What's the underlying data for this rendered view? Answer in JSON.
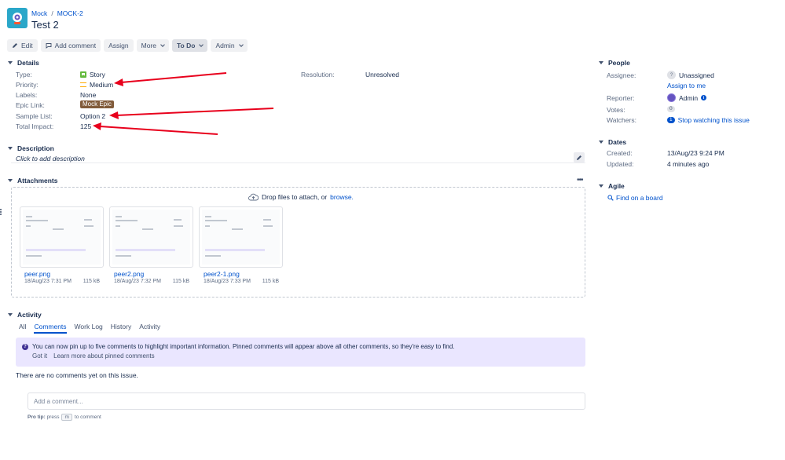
{
  "header": {
    "project_name": "Mock",
    "issue_key": "MOCK-2",
    "separator": "/",
    "title": "Test 2"
  },
  "toolbar": {
    "edit": "Edit",
    "add_comment": "Add comment",
    "assign": "Assign",
    "more": "More",
    "status": "To Do",
    "admin": "Admin"
  },
  "details": {
    "heading": "Details",
    "type_label": "Type:",
    "type_value": "Story",
    "priority_label": "Priority:",
    "priority_value": "Medium",
    "labels_label": "Labels:",
    "labels_value": "None",
    "epic_label": "Epic Link:",
    "epic_value": "Mock Epic",
    "sample_label": "Sample List:",
    "sample_value": "Option 2",
    "impact_label": "Total Impact:",
    "impact_value": "125",
    "resolution_label": "Resolution:",
    "resolution_value": "Unresolved"
  },
  "description": {
    "heading": "Description",
    "placeholder": "Click to add description"
  },
  "attachments": {
    "heading": "Attachments",
    "drop_text": "Drop files to attach, or",
    "browse": "browse.",
    "files": [
      {
        "name": "peer.png",
        "date": "18/Aug/23 7:31 PM",
        "size": "115 kB"
      },
      {
        "name": "peer2.png",
        "date": "18/Aug/23 7:32 PM",
        "size": "115 kB"
      },
      {
        "name": "peer2-1.png",
        "date": "18/Aug/23 7:33 PM",
        "size": "115 kB"
      }
    ]
  },
  "activity": {
    "heading": "Activity",
    "tabs": [
      "All",
      "Comments",
      "Work Log",
      "History",
      "Activity"
    ],
    "active_tab": "Comments",
    "banner_text": "You can now pin up to five comments to highlight important information. Pinned comments will appear above all other comments, so they're easy to find.",
    "banner_got_it": "Got it",
    "banner_learn": "Learn more about pinned comments",
    "no_comments": "There are no comments yet on this issue.",
    "comment_placeholder": "Add a comment...",
    "pro_tip_label": "Pro tip:",
    "pro_tip_press": "press",
    "pro_tip_key": "m",
    "pro_tip_suffix": "to comment"
  },
  "people": {
    "heading": "People",
    "assignee_label": "Assignee:",
    "assignee_value": "Unassigned",
    "assign_to_me": "Assign to me",
    "reporter_label": "Reporter:",
    "reporter_value": "Admin",
    "votes_label": "Votes:",
    "votes_value": "0",
    "watchers_label": "Watchers:",
    "watchers_count": "1",
    "watchers_action": "Stop watching this issue"
  },
  "dates": {
    "heading": "Dates",
    "created_label": "Created:",
    "created_value": "13/Aug/23 9:24 PM",
    "updated_label": "Updated:",
    "updated_value": "4 minutes ago"
  },
  "agile": {
    "heading": "Agile",
    "find_on_board": "Find on a board"
  },
  "colors": {
    "link": "#0052cc",
    "annotation_arrow": "#e8001c",
    "epic": "#815b3a",
    "story": "#63ba3c",
    "priority_medium": "#ffab00",
    "banner_bg": "#eae6ff"
  }
}
